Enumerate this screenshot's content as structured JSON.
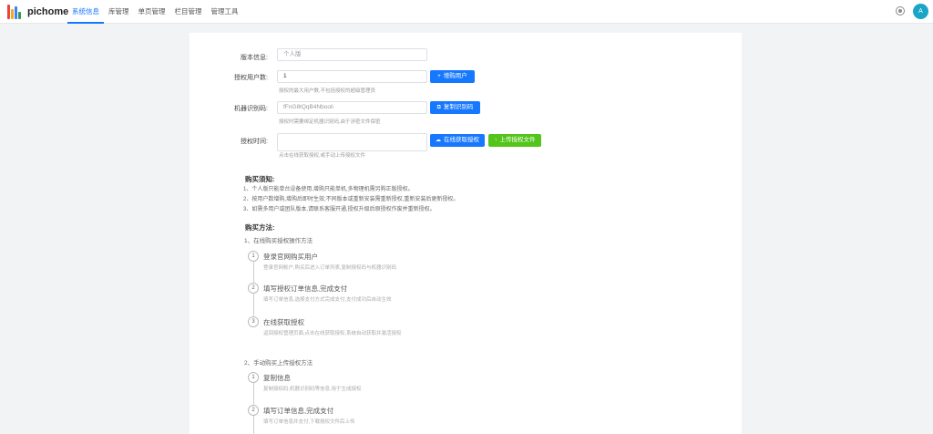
{
  "header": {
    "brand": "pichome",
    "nav": [
      "系统信息",
      "库管理",
      "单页管理",
      "栏目管理",
      "管理工具"
    ],
    "active_index": 0,
    "avatar_initial": "A",
    "accent": "#1677ff"
  },
  "form": {
    "version": {
      "label": "版本信息:",
      "value": "个人版"
    },
    "users": {
      "label": "授权用户数:",
      "value": "1",
      "hint": "授权的最大用户数,不包括授权的超级管理员",
      "button": "增购用户"
    },
    "machine": {
      "label": "机器识别码:",
      "value": "fFnG8tQqB4Nbooli",
      "hint": "授权时需要绑定机器识别码,由于涉密文件保密",
      "button": "复制识别码"
    },
    "license": {
      "label": "授权时间:",
      "value": "",
      "hint": "点击在线获取授权,或手动上传授权文件",
      "btn_online": "在线获取授权",
      "btn_upload": "上传授权文件"
    }
  },
  "rules": {
    "title": "购买须知:",
    "items": [
      "1、个人版只能单台设备使用,增购只能单机,多物理机需另购正版授权。",
      "2、按用户数增购,增购后即时生效;不同版本或重新安装需重新授权,重新安装后更新授权。",
      "3、如需多用户或团队版本,请联系客服开通,授权升级后原授权作废并重新授权。"
    ]
  },
  "methods": {
    "title": "购买方法:",
    "online_title": "1、在线购买授权操作方法",
    "online_steps": [
      {
        "num": "1",
        "title": "登录官网购买用户",
        "desc": "登录官网帐户,购买后进入订单列表,复制授权码与机器识别码"
      },
      {
        "num": "2",
        "title": "填写授权订单信息,完成支付",
        "desc": "填写订单信息,选择支付方式完成支付,支付成功后自动生效"
      },
      {
        "num": "3",
        "title": "在线获取授权",
        "desc": "返回授权管理页面,点击在线获取授权,系统自动获取并激活授权"
      }
    ],
    "manual_title": "2、手动购买上传授权方法",
    "manual_steps": [
      {
        "num": "1",
        "title": "复制信息",
        "desc": "复制授权码,机器识别码等信息,用于生成授权"
      },
      {
        "num": "2",
        "title": "填写订单信息,完成支付",
        "desc": "填写订单信息并支付,下载授权文件后上传"
      }
    ]
  }
}
